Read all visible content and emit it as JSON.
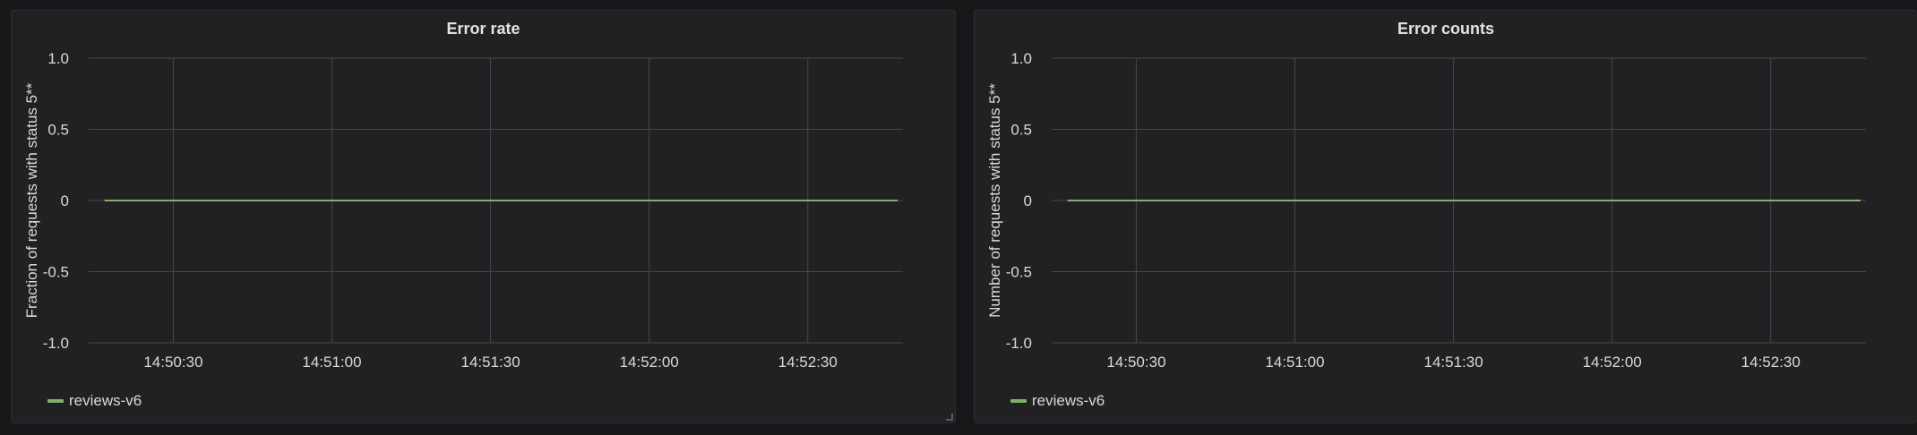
{
  "panels": [
    {
      "title": "Error rate",
      "legend_label": "reviews-v6"
    },
    {
      "title": "Error counts",
      "legend_label": "reviews-v6"
    }
  ],
  "colors": {
    "series": "#7eb26d",
    "grid": "#464749",
    "background": "#212124"
  },
  "chart_data": [
    {
      "type": "line",
      "title": "Error rate",
      "xlabel": "",
      "ylabel": "Fraction of requests with status 5**",
      "ylim": [
        -1.0,
        1.0
      ],
      "yticks": [
        1.0,
        0.5,
        0,
        -0.5,
        -1.0
      ],
      "ytick_labels": [
        "1.0",
        "0.5",
        "0",
        "-0.5",
        "-1.0"
      ],
      "xlim": [
        "14:50:14",
        "14:52:48"
      ],
      "xticks": [
        "14:50:30",
        "14:51:00",
        "14:51:30",
        "14:52:00",
        "14:52:30"
      ],
      "grid": true,
      "legend_position": "bottom-left",
      "series": [
        {
          "name": "reviews-v6",
          "x": [
            "14:50:17",
            "14:52:47"
          ],
          "values": [
            0,
            0
          ]
        }
      ]
    },
    {
      "type": "line",
      "title": "Error counts",
      "xlabel": "",
      "ylabel": "Number of requests with status 5**",
      "ylim": [
        -1.0,
        1.0
      ],
      "yticks": [
        1.0,
        0.5,
        0,
        -0.5,
        -1.0
      ],
      "ytick_labels": [
        "1.0",
        "0.5",
        "0",
        "-0.5",
        "-1.0"
      ],
      "xlim": [
        "14:50:14",
        "14:52:48"
      ],
      "xticks": [
        "14:50:30",
        "14:51:00",
        "14:51:30",
        "14:52:00",
        "14:52:30"
      ],
      "grid": true,
      "legend_position": "bottom-left",
      "series": [
        {
          "name": "reviews-v6",
          "x": [
            "14:50:17",
            "14:52:47"
          ],
          "values": [
            0,
            0
          ]
        }
      ]
    }
  ]
}
